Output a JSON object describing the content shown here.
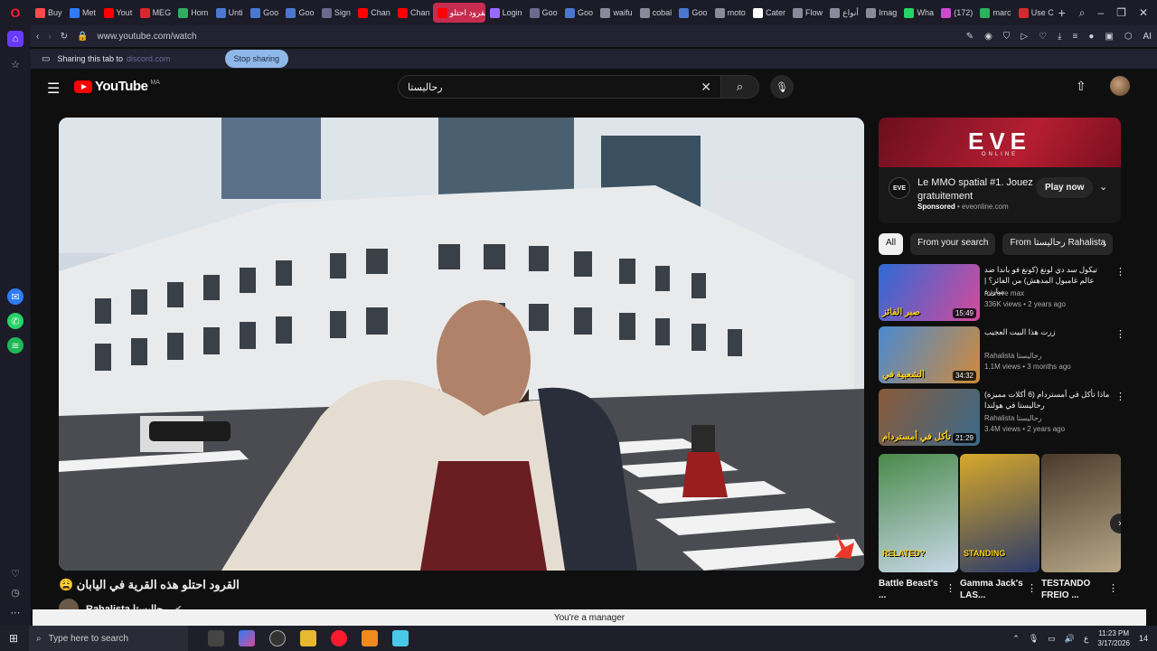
{
  "browser": {
    "tabs": [
      {
        "label": "Buy",
        "color": "#ff4a4a"
      },
      {
        "label": "Met",
        "color": "#2d7cf6"
      },
      {
        "label": "Yout",
        "color": "#ff0000"
      },
      {
        "label": "MEG",
        "color": "#d9272e"
      },
      {
        "label": "Hom",
        "color": "#2eaf5d"
      },
      {
        "label": "Unti",
        "color": "#4a78d0"
      },
      {
        "label": "Goo",
        "color": "#4a78d0"
      },
      {
        "label": "Goo",
        "color": "#4a78d0"
      },
      {
        "label": "Sign",
        "color": "#6a6a8a"
      },
      {
        "label": "Chan",
        "color": "#ff0000"
      },
      {
        "label": "Chan",
        "color": "#ff0000"
      },
      {
        "label": "القرود احتلو",
        "color": "#ff0000",
        "active": true
      },
      {
        "label": "Login",
        "color": "#9a6aff"
      },
      {
        "label": "Goo",
        "color": "#6a6a8a"
      },
      {
        "label": "Goo",
        "color": "#4a78d0"
      },
      {
        "label": "waifu",
        "color": "#8a8a9a"
      },
      {
        "label": "cobal",
        "color": "#8a8a9a"
      },
      {
        "label": "Goo",
        "color": "#4a78d0"
      },
      {
        "label": "moto",
        "color": "#8a8a9a"
      },
      {
        "label": "Cater",
        "color": "#ffffff"
      },
      {
        "label": "Flow",
        "color": "#8a8a9a"
      },
      {
        "label": "أنواع",
        "color": "#8a8a9a"
      },
      {
        "label": "Imag",
        "color": "#8a8a9a"
      },
      {
        "label": "Wha",
        "color": "#25d366"
      },
      {
        "label": "(172)",
        "color": "#d04ad0"
      },
      {
        "label": "marc",
        "color": "#2eaf5d"
      },
      {
        "label": "Use C",
        "color": "#d9272e"
      }
    ],
    "url": "www.youtube.com/watch",
    "ai_label": "AI",
    "share_text": "Sharing this tab to",
    "share_target": "discord.com",
    "stop_sharing": "Stop sharing"
  },
  "youtube": {
    "region": "MA",
    "logo_word": "YouTube",
    "search_query": "رحالیستا",
    "video_title": "القرود احتلو هذه القرية في اليابان 😩",
    "channel_name": "Rahalista رحالیستا",
    "ad": {
      "brand": "EVE",
      "brand_sub": "ONLINE",
      "logo_text": "EVE",
      "headline": "Le MMO spatial #1. Jouez gratuitement",
      "sponsored": "Sponsored",
      "domain": "eveonline.com",
      "cta": "Play now"
    },
    "chips": [
      "All",
      "From your search",
      "From رحالیستا Rahalista"
    ],
    "recommendations": [
      {
        "title": "تيكول سد دي لونغ (كونغ فو باندا ضد عالم غامبول المدهش) من الفائز؟ | مبارزة",
        "channel": "marove max",
        "views": "336K views • 2 years ago",
        "duration": "15:49",
        "c1": "#2d6ad6",
        "c2": "#d64a9a"
      },
      {
        "title": "زرت هذا البيت العجيب",
        "channel": "Rahalista رحالیستا",
        "views": "1.1M views • 3 months ago",
        "duration": "34:32",
        "c1": "#4a8ad0",
        "c2": "#d08a3a"
      },
      {
        "title": "ماذا تأكل في أمستردام (6 أكلات مميزة) رحالیستا في هولندا",
        "channel": "Rahalista رحالیستا",
        "views": "3.4M views • 2 years ago",
        "duration": "21:29",
        "c1": "#8a5a3a",
        "c2": "#3a6a8a"
      }
    ],
    "rec_captions": [
      "صبر الفائز",
      "الشعبية في",
      "تأكل في أمستردام"
    ],
    "shorts": [
      {
        "title": "Battle Beast's ...",
        "caption": "RELATED?",
        "c1": "#4a8a4a",
        "c2": "#c8d8e8"
      },
      {
        "title": "Gamma Jack's LAS...",
        "caption": "STANDING",
        "c1": "#d8a82a",
        "c2": "#2a3a6a"
      },
      {
        "title": "TESTANDO FREIO ...",
        "caption": "",
        "c1": "#4a3a2a",
        "c2": "#b8a888"
      }
    ]
  },
  "toast": "You're a manager",
  "taskbar": {
    "search_placeholder": "Type here to search",
    "time": "11:23 PM",
    "date": "3/17/2026",
    "lang": "ع",
    "notif": "14"
  }
}
